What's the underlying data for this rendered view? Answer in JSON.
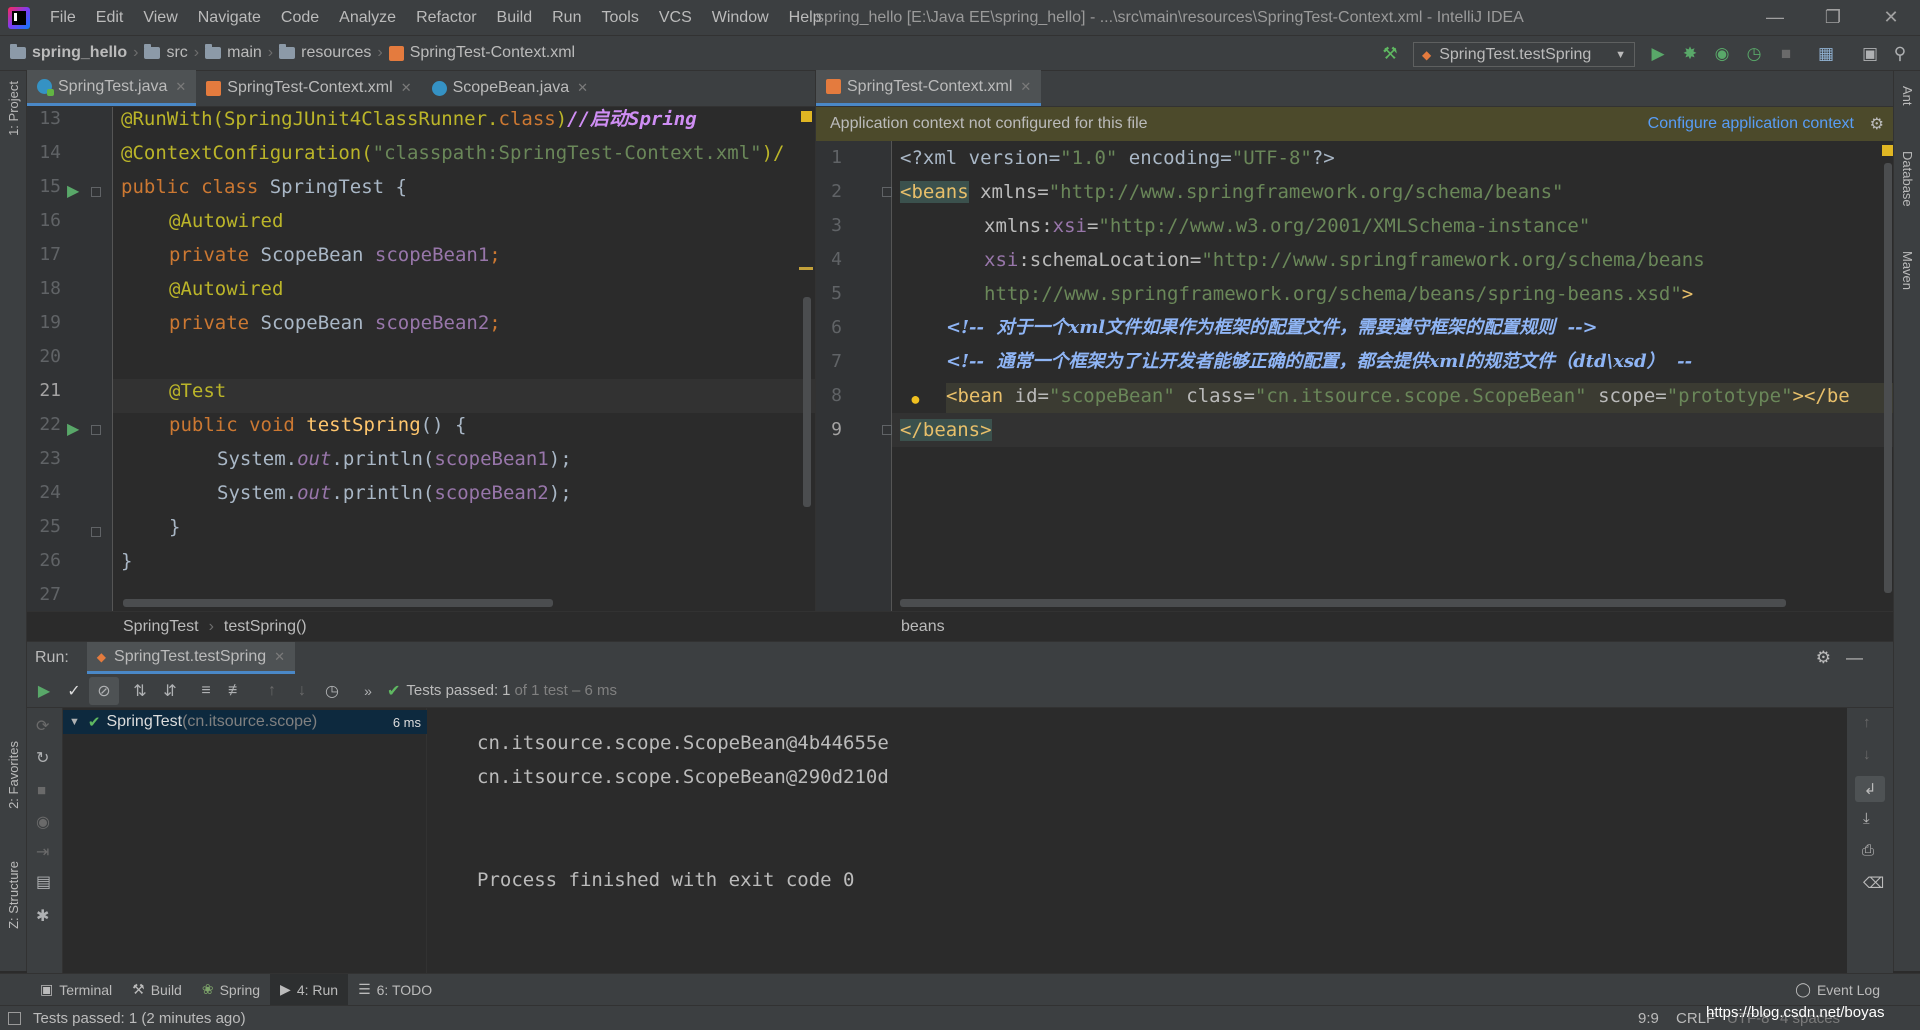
{
  "app": {
    "window_title": "spring_hello [E:\\Java EE\\spring_hello] - ...\\src\\main\\resources\\SpringTest-Context.xml - IntelliJ IDEA"
  },
  "menu": [
    "File",
    "Edit",
    "View",
    "Navigate",
    "Code",
    "Analyze",
    "Refactor",
    "Build",
    "Run",
    "Tools",
    "VCS",
    "Window",
    "Help"
  ],
  "breadcrumb": [
    "spring_hello",
    "src",
    "main",
    "resources",
    "SpringTest-Context.xml"
  ],
  "run_config": "SpringTest.testSpring",
  "left_tool_labels": {
    "project": "1: Project",
    "favorites": "2: Favorites",
    "structure": "Z: Structure"
  },
  "right_tool_labels": {
    "ant": "Ant",
    "database": "Database",
    "maven": "Maven"
  },
  "left_tabs": [
    {
      "label": "SpringTest.java"
    },
    {
      "label": "SpringTest-Context.xml"
    },
    {
      "label": "ScopeBean.java"
    }
  ],
  "right_tabs": [
    {
      "label": "SpringTest-Context.xml"
    }
  ],
  "java_lines": [
    "13",
    "14",
    "15",
    "16",
    "17",
    "18",
    "19",
    "20",
    "21",
    "22",
    "23",
    "24",
    "25",
    "26",
    "27"
  ],
  "java_code": {
    "l13a": "@RunWith(SpringJUnit4ClassRunner.",
    "l13b": "class",
    "l13c": ")",
    "l13d": "//启动Spring",
    "l14a": "@ContextConfiguration(",
    "l14b": "\"classpath:SpringTest-Context.xml\"",
    "l14c": ")/",
    "l15a": "public class ",
    "l15b": "SpringTest {",
    "l16": "@Autowired",
    "l17a": "private ",
    "l17b": "ScopeBean ",
    "l17c": "scopeBean1",
    "l17d": ";",
    "l18": "@Autowired",
    "l19a": "private ",
    "l19b": "ScopeBean ",
    "l19c": "scopeBean2",
    "l19d": ";",
    "l21": "@Test",
    "l22a": "public void ",
    "l22b": "testSpring",
    "l22c": "() {",
    "l23a": "System.",
    "l23b": "out",
    "l23c": ".println(",
    "l23d": "scopeBean1",
    "l23e": ");",
    "l24a": "System.",
    "l24b": "out",
    "l24c": ".println(",
    "l24d": "scopeBean2",
    "l24e": ");",
    "l25": "}",
    "l26": "}"
  },
  "java_crumbs": [
    "SpringTest",
    "testSpring()"
  ],
  "xml_banner": {
    "text": "Application context not configured for this file",
    "link": "Configure application context"
  },
  "xml_lines": [
    "1",
    "2",
    "3",
    "4",
    "5",
    "6",
    "7",
    "8",
    "9"
  ],
  "xml_code": {
    "l1a": "<?xml version=",
    "l1b": "\"1.0\"",
    "l1c": " encoding=",
    "l1d": "\"UTF-8\"",
    "l1e": "?>",
    "l2a": "<beans",
    "l2b": " xmlns=",
    "l2c": "\"http://www.springframework.org/schema/beans\"",
    "l3a": "xmlns:",
    "l3b": "xsi",
    "l3c": "=",
    "l3d": "\"http://www.w3.org/2001/XMLSchema-instance\"",
    "l4a": "xsi",
    "l4b": ":schemaLocation=",
    "l4c": "\"http://www.springframework.org/schema/beans",
    "l5a": "http://www.springframework.org/schema/beans/spring-beans.xsd\"",
    "l5b": ">",
    "l6": "<!--  对于一个xml文件如果作为框架的配置文件，需要遵守框架的配置规则  -->",
    "l7": "<!--  通常一个框架为了让开发者能够正确的配置，都会提供xml的规范文件（dtd\\xsd）  --",
    "l8a": "<bean",
    "l8b": " id=",
    "l8c": "\"scopeBean\"",
    "l8d": " class=",
    "l8e": "\"cn.itsource.scope.ScopeBean\"",
    "l8f": " scope=",
    "l8g": "\"prototype\"",
    "l8h": "></be",
    "l9": "</beans>"
  },
  "xml_crumbs": [
    "beans"
  ],
  "run_panel": {
    "label": "Run:",
    "tab": "SpringTest.testSpring",
    "status_prefix": "Tests passed: ",
    "status_count": "1",
    "status_suffix": " of 1 test – 6 ms",
    "tree_item": "SpringTest",
    "tree_pkg": " (cn.itsource.scope)",
    "tree_time": "6 ms",
    "console": [
      "cn.itsource.scope.ScopeBean@4b44655e",
      "cn.itsource.scope.ScopeBean@290d210d",
      "Process finished with exit code 0"
    ]
  },
  "bottom_tabs": [
    "Terminal",
    "Build",
    "Spring",
    "4: Run",
    "6: TODO"
  ],
  "event_log": "Event Log",
  "status": {
    "message": "Tests passed: 1 (2 minutes ago)",
    "position": "9:9",
    "line_sep": "CRLF",
    "encoding": "UTF-8",
    "indent": "4 spaces",
    "watermark": "https://blog.csdn.net/boyas"
  },
  "colors": {
    "accent": "#4a88c7",
    "pass": "#5fb861",
    "keyword": "#cc7832",
    "string": "#6a8759"
  }
}
